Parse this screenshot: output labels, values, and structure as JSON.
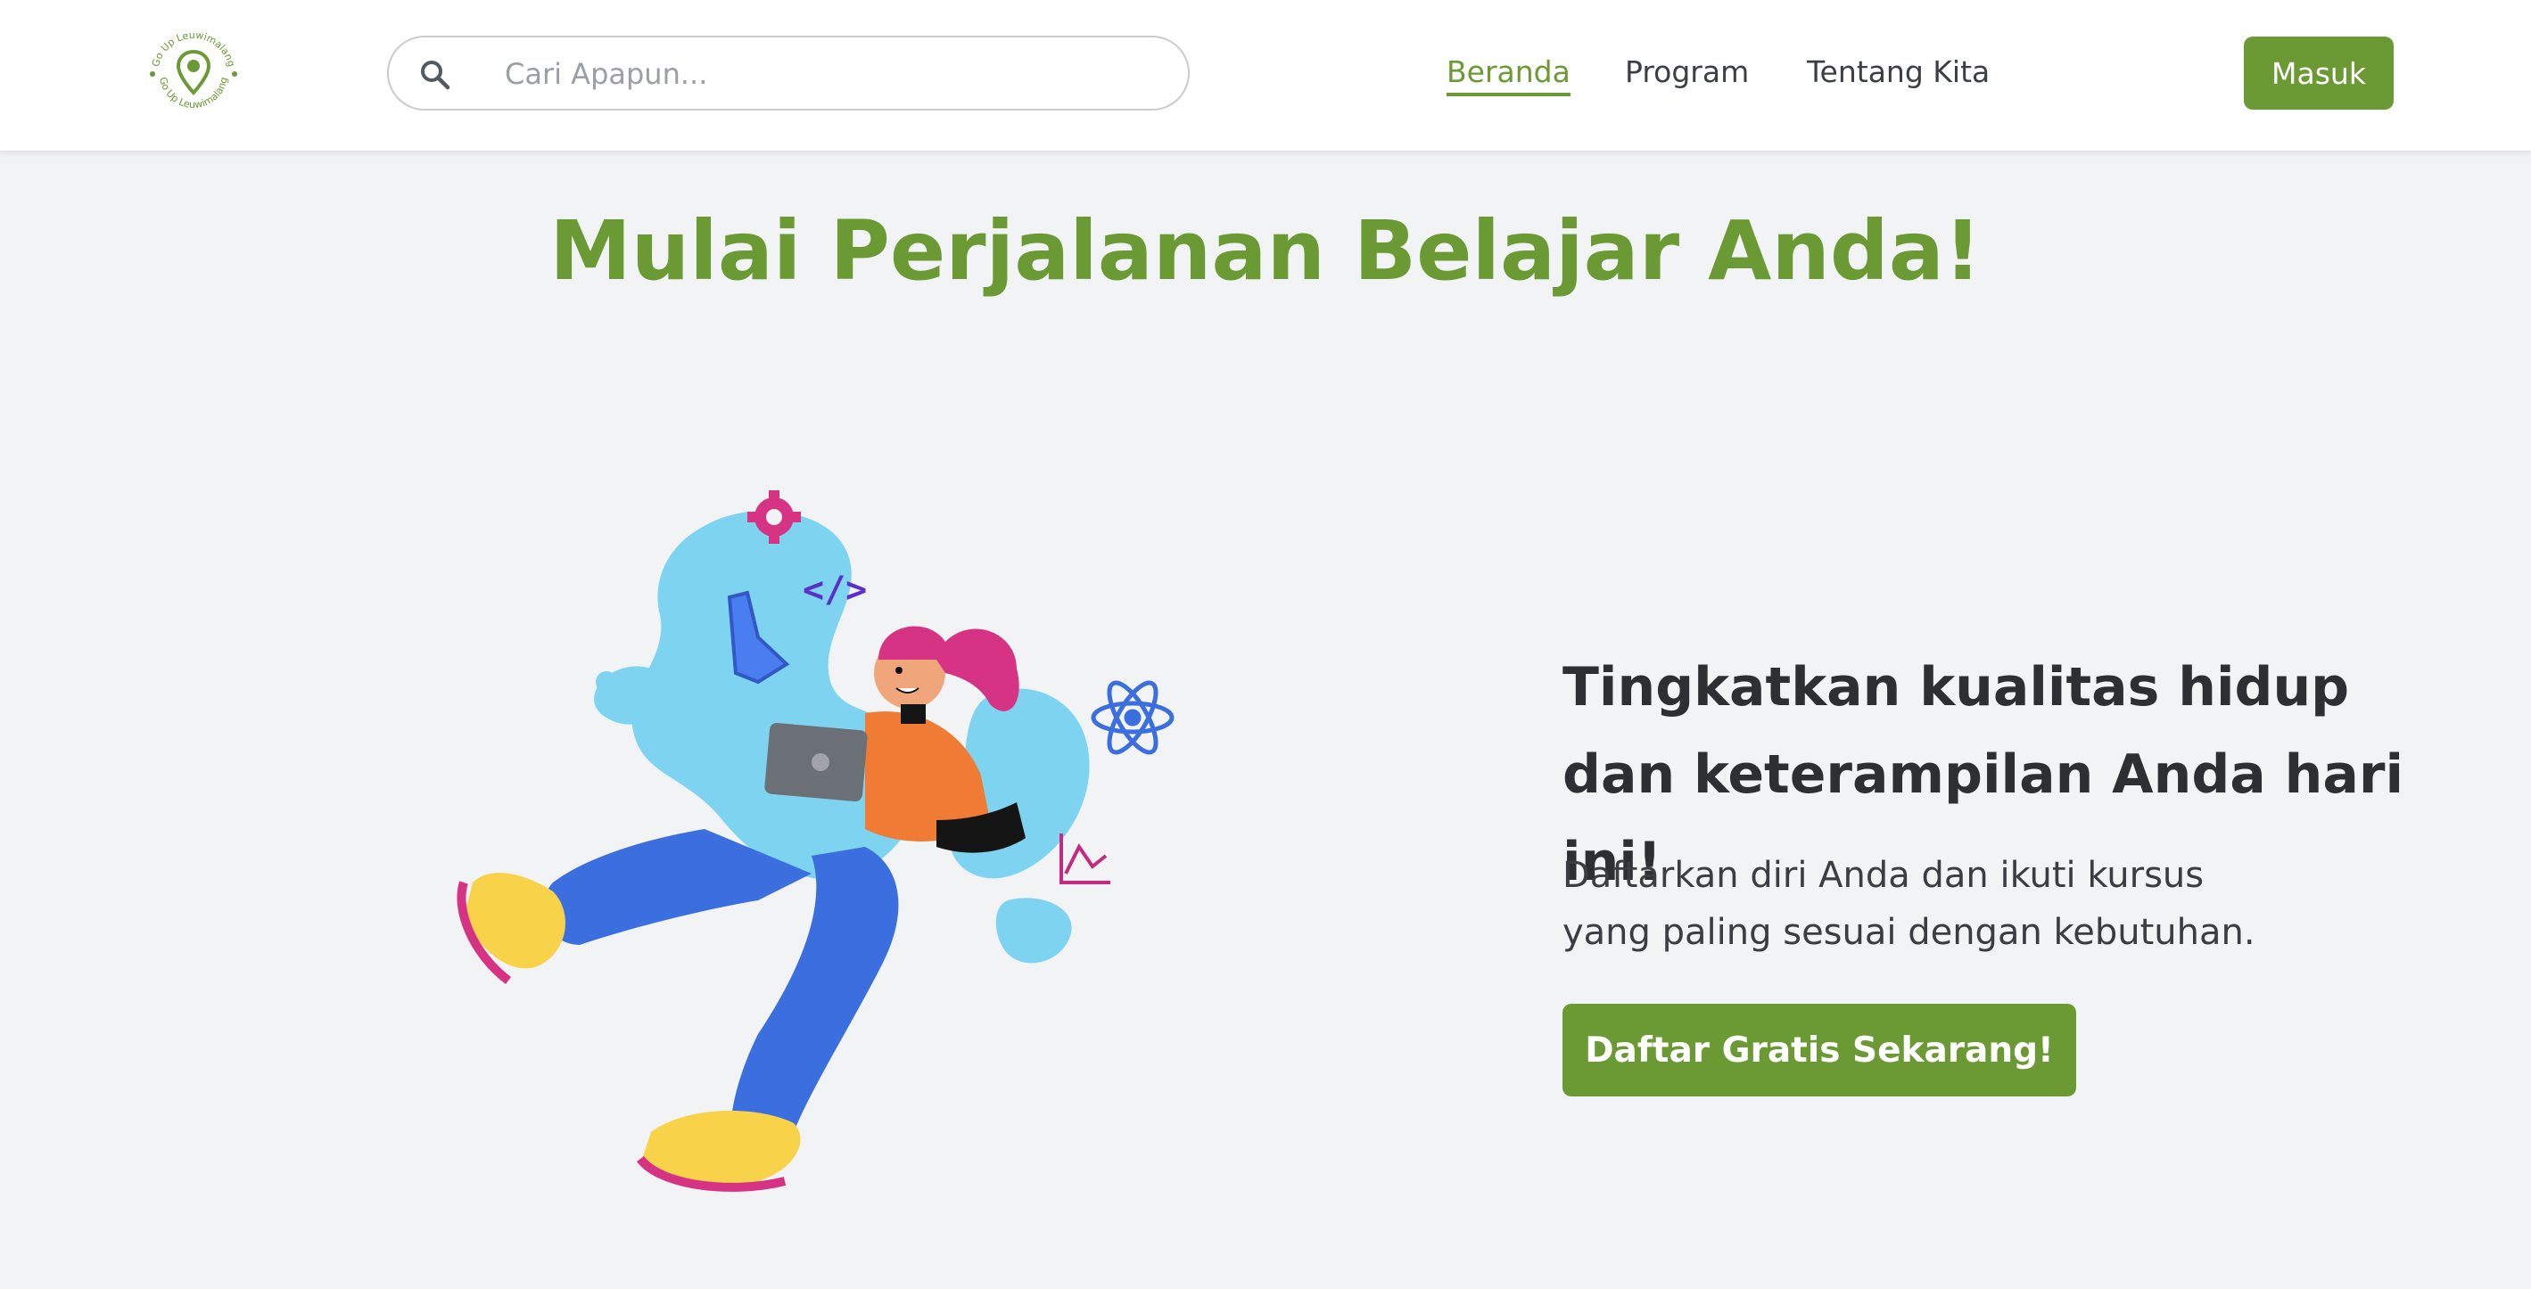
{
  "brand": {
    "logo_text_top": "Go Up Leuwimalang",
    "logo_text_bottom": "Go Up Leuwimalang",
    "color": "#6b9a34"
  },
  "search": {
    "placeholder": "Cari Apapun...",
    "icon": "search-icon"
  },
  "nav": {
    "items": [
      {
        "label": "Beranda",
        "active": true
      },
      {
        "label": "Program",
        "active": false
      },
      {
        "label": "Tentang Kita",
        "active": false
      }
    ],
    "login_label": "Masuk"
  },
  "hero": {
    "title_bold": "Mulai Perjalanan",
    "title_light": "Belajar Anda!",
    "subheading": "Tingkatkan kualitas hidup dan keterampilan Anda hari ini!",
    "description_line1": "Daftarkan diri Anda dan ikuti kursus",
    "description_line2": "yang paling sesuai dengan kebutuhan.",
    "cta_label": "Daftar Gratis Sekarang!"
  },
  "colors": {
    "accent": "#6b9a34",
    "background": "#f2f3f5",
    "text_dark": "#2d2f33"
  }
}
